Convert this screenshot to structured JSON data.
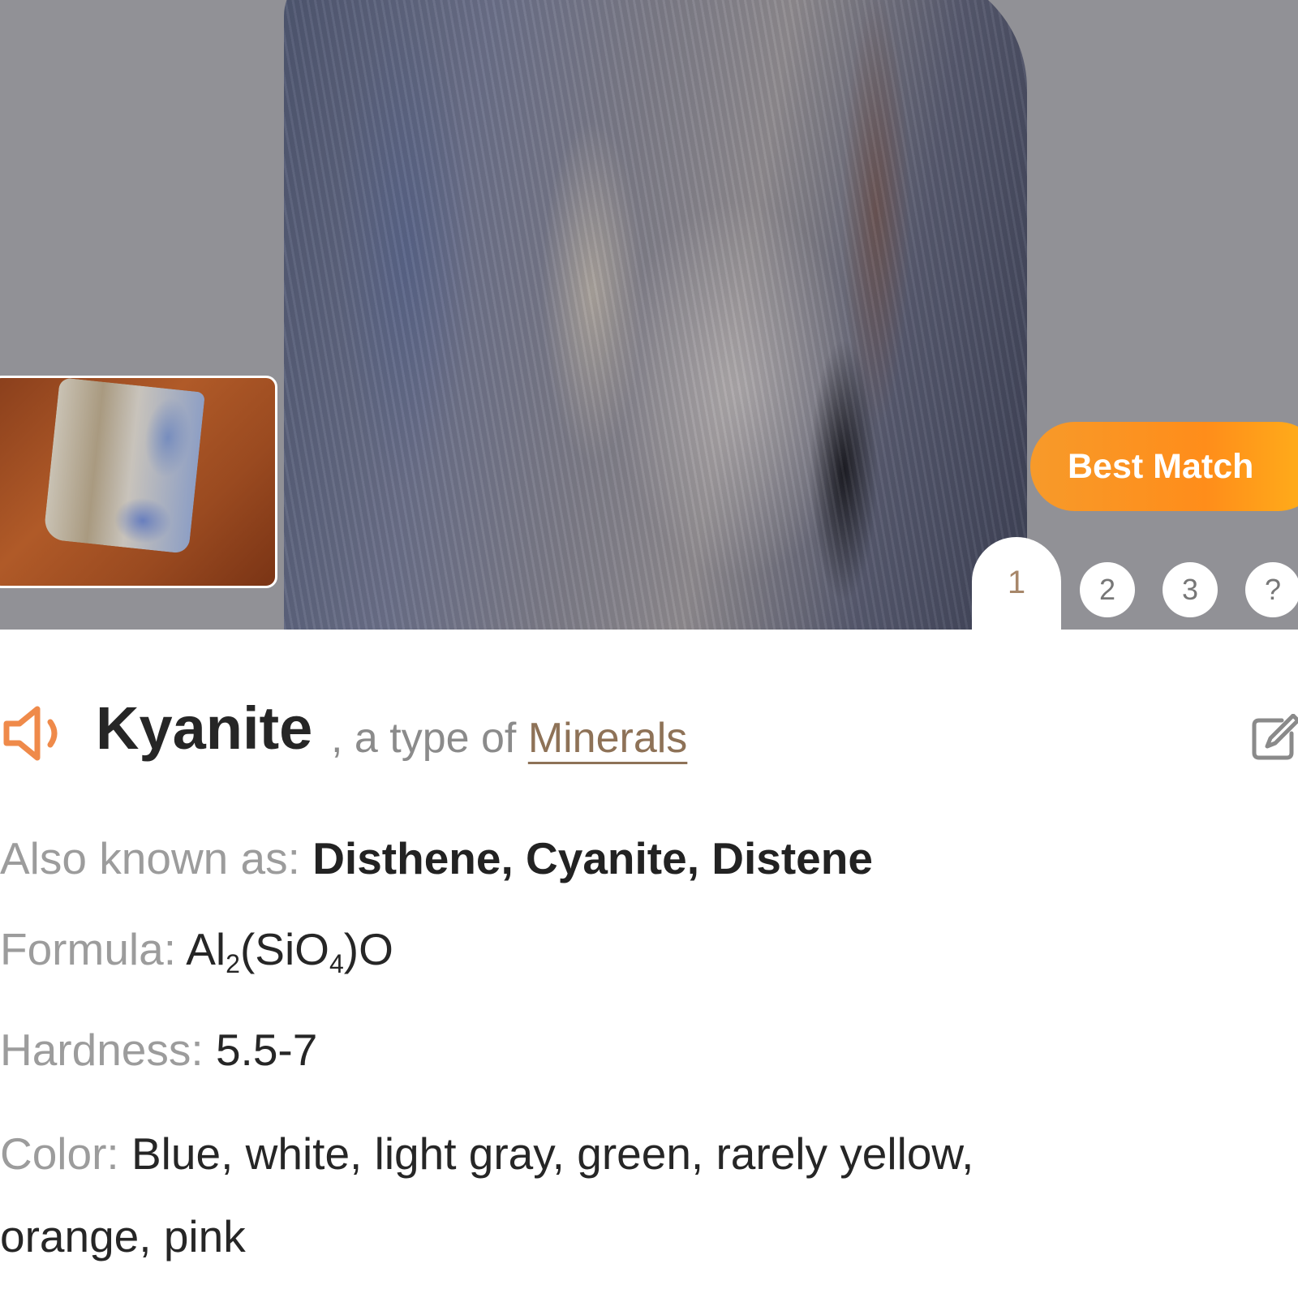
{
  "badge": {
    "best_match": "Best Match"
  },
  "result_tabs": [
    "1",
    "2",
    "3",
    "?"
  ],
  "mineral": {
    "name": "Kyanite",
    "separator": ", a type of ",
    "category": "Minerals"
  },
  "details": {
    "also_known_as": {
      "label": "Also known as: ",
      "value": "Disthene, Cyanite, Distene"
    },
    "formula": {
      "label": "Formula: ",
      "parts": [
        "Al",
        "2",
        "(SiO",
        "4",
        ")O"
      ]
    },
    "hardness": {
      "label": "Hardness: ",
      "value": "5.5-7"
    },
    "color": {
      "label": "Color: ",
      "value_line1": "Blue, white, light gray, green, rarely yellow,",
      "value_line2": "orange, pink"
    }
  },
  "colors": {
    "accent": "#f79a2a",
    "link": "#8e7257",
    "label": "#9c9c9c",
    "text": "#262626"
  },
  "icons": {
    "speaker": "speaker-icon",
    "edit": "edit-icon"
  }
}
